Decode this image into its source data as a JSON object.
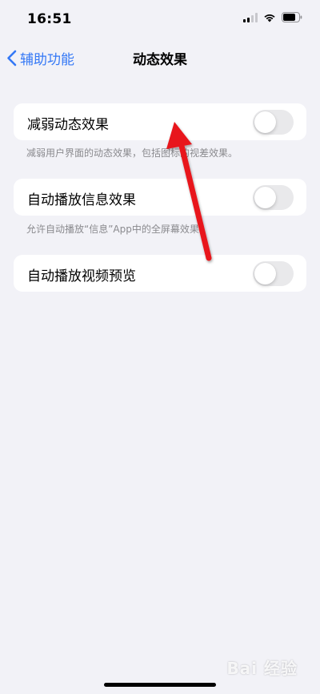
{
  "status_bar": {
    "time": "16:51",
    "icons": [
      "cellular-signal-icon",
      "wifi-icon",
      "battery-icon"
    ]
  },
  "nav": {
    "back_label": "辅助功能",
    "title": "动态效果"
  },
  "settings": [
    {
      "label": "减弱动态效果",
      "toggle_on": false,
      "footnote": "减弱用户界面的动态效果，包括图标的视差效果。"
    },
    {
      "label": "自动播放信息效果",
      "toggle_on": false,
      "footnote": "允许自动播放“信息”App中的全屏幕效果。"
    },
    {
      "label": "自动播放视频预览",
      "toggle_on": false
    }
  ],
  "watermark": "Bai 经验",
  "colors": {
    "accent": "#3478f6",
    "background": "#f2f2f7",
    "toggle_off": "#e9e9eb",
    "annotation_arrow": "#e8151b"
  }
}
